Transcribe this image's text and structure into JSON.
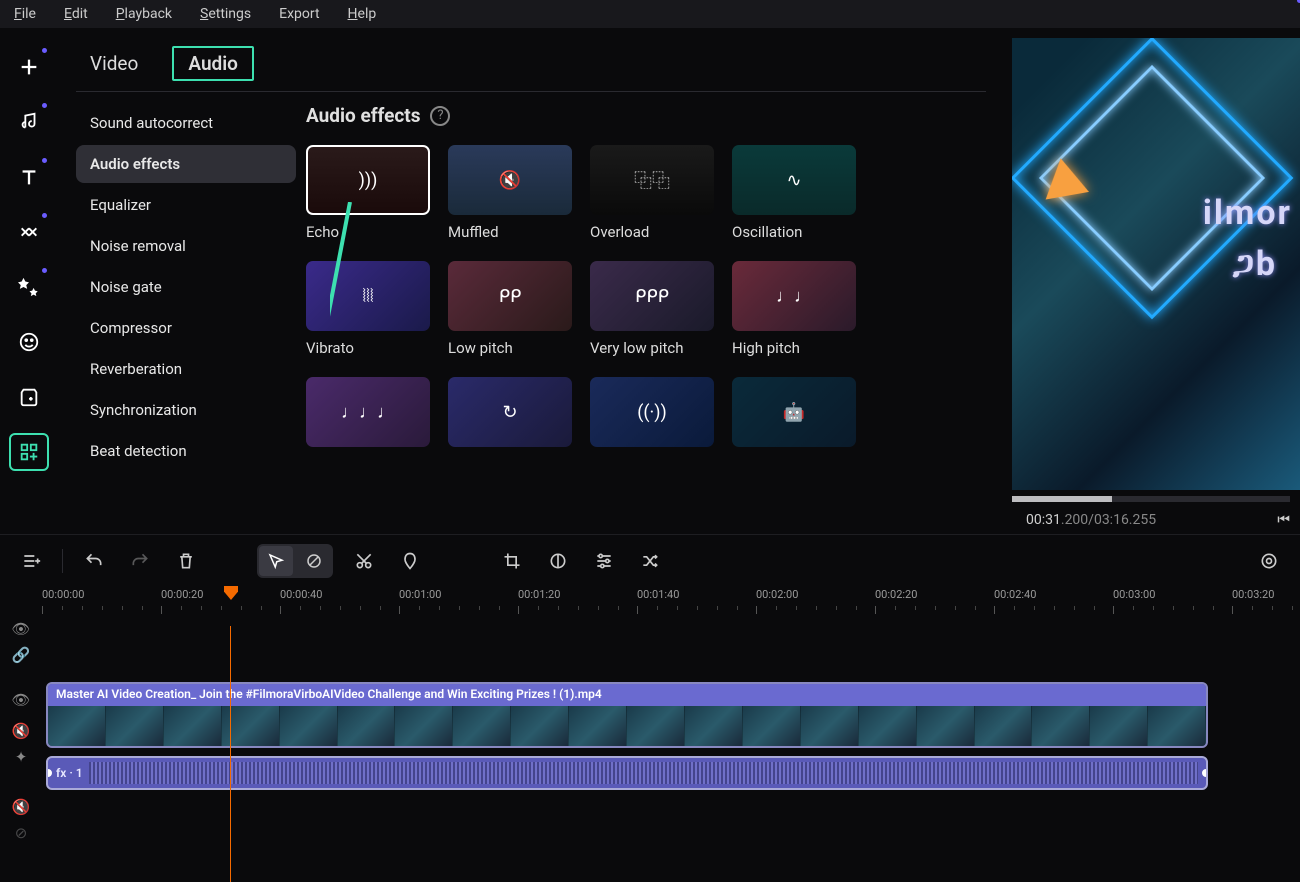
{
  "menu": {
    "file": "File",
    "edit": "Edit",
    "playback": "Playback",
    "settings": "Settings",
    "export": "Export",
    "help": "Help"
  },
  "tabs": {
    "video": "Video",
    "audio": "Audio"
  },
  "sublist": [
    "Sound autocorrect",
    "Audio effects",
    "Equalizer",
    "Noise removal",
    "Noise gate",
    "Compressor",
    "Reverberation",
    "Synchronization",
    "Beat detection"
  ],
  "sublist_active": 1,
  "effects_title": "Audio effects",
  "effects": [
    {
      "label": "Echo",
      "bg": "linear-gradient(180deg,#2a1a1a,#1a0a0a)",
      "glyph": ")‎)‎)",
      "sel": true
    },
    {
      "label": "Muffled",
      "bg": "linear-gradient(180deg,#2a3a5a,#1a2a3a)",
      "glyph": "🔇"
    },
    {
      "label": "Overload",
      "bg": "linear-gradient(180deg,#1a1a1a,#0a0a0a)",
      "glyph": "⿻⿻"
    },
    {
      "label": "Oscillation",
      "bg": "linear-gradient(180deg,#0a3a3a,#0a2a2a)",
      "glyph": "∿"
    },
    {
      "label": "Vibrato",
      "bg": "linear-gradient(135deg,#3a2a8a,#1a1a4a)",
      "glyph": "⦚⦚⦚"
    },
    {
      "label": "Low pitch",
      "bg": "linear-gradient(135deg,#5a2a3a,#2a1a1a)",
      "glyph": "ᑭᑭ"
    },
    {
      "label": "Very low pitch",
      "bg": "linear-gradient(135deg,#3a2a4a,#1a1a2a)",
      "glyph": "ᑭᑭᑭ"
    },
    {
      "label": "High pitch",
      "bg": "linear-gradient(135deg,#6a2a3a,#2a1a2a)",
      "glyph": "♩♩"
    },
    {
      "label": "",
      "bg": "linear-gradient(135deg,#4a2a6a,#2a1a3a)",
      "glyph": "♩♩♩"
    },
    {
      "label": "",
      "bg": "linear-gradient(135deg,#2a2a6a,#1a1a3a)",
      "glyph": "↻"
    },
    {
      "label": "",
      "bg": "linear-gradient(135deg,#1a2a5a,#0a1a3a)",
      "glyph": "((·))"
    },
    {
      "label": "",
      "bg": "linear-gradient(135deg,#0a2a3a,#0a1a2a)",
      "glyph": "🤖"
    }
  ],
  "preview": {
    "text1": "ilmor",
    "text2": "ጋb",
    "time1": "00:31",
    "time_ms": ".200",
    "time2": "/03:16.255"
  },
  "ruler": [
    "00:00:00",
    "00:00:20",
    "00:00:40",
    "00:01:00",
    "00:01:20",
    "00:01:40",
    "00:02:00",
    "00:02:20",
    "00:02:40",
    "00:03:00",
    "00:03:20"
  ],
  "clip": {
    "title": "Master AI Video Creation_ Join the #FilmoraVirboAIVideo Challenge and Win Exciting Prizes ! (1).mp4",
    "fx": "fx · 1"
  }
}
